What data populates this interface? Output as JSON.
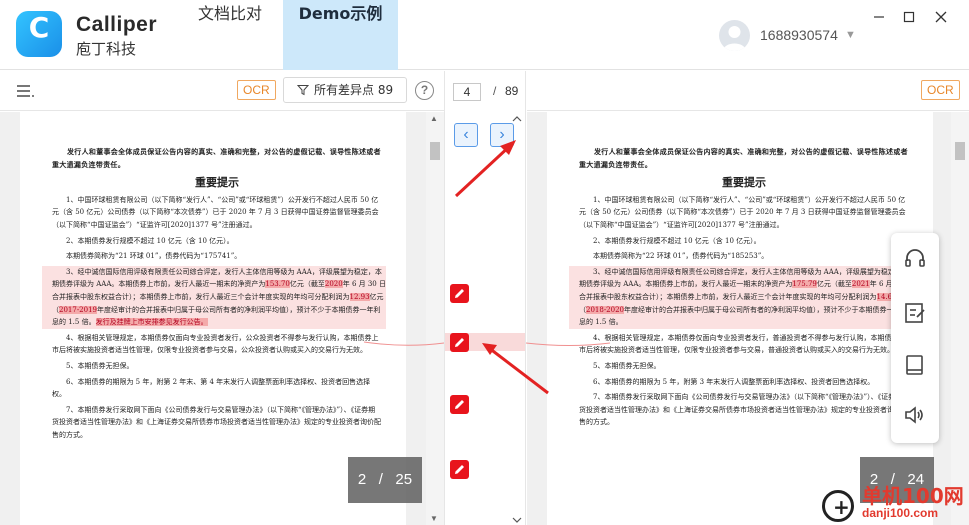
{
  "app": {
    "brand_name": "Calliper",
    "brand_subtitle": "庖丁科技",
    "logo_letter": "C",
    "tabs": [
      {
        "label": "文档比对",
        "active": false
      },
      {
        "label": "Demo示例",
        "active": true
      }
    ],
    "user": {
      "name": "1688930574"
    }
  },
  "colors": {
    "accent": "#1a8fe8",
    "active_tab_bg": "#cde8fa",
    "diff_red": "#e8141c",
    "ocr_orange": "#e8872a"
  },
  "toolbar": {
    "ocr_label": "OCR",
    "diff_filter_label": "所有差异点 89",
    "help_symbol": "?"
  },
  "navigator": {
    "current_diff": "4",
    "separator": "/",
    "total_diffs": "89",
    "prev_symbol": "‹",
    "next_symbol": "›"
  },
  "left_doc": {
    "header": "发行人和董事会全体成员保证公告内容的真实、准确和完整，对公告的虚假记载、误导性陈述或者重大遗漏负连带责任。",
    "heading": "重要提示",
    "p1": "1、中国环球租赁有限公司（以下简称“发行人”、“公司”或“环球租赁”）公开发行不超过人民币 50 亿元（含 50 亿元）公司债券（以下简称“本次债券”）已于 2020 年 7 月 3 日获得中国证券监督管理委员会（以下简称“中国证监会”）“证监许可[2020]1377 号”注册通过。",
    "p2": "2、本期债券发行规模不超过 10 亿元（含 10 亿元）。",
    "p3": "本期债券简称为“21 环球 01”，债券代码为“175741”。",
    "p4_a": "3、经中诚信国际信用评级有限责任公司综合评定，发行人主体信用等级为 AAA，评级展望为稳定，本期债券评级为 AAA。本期债券上市前，发行人最近一期末的净资产为",
    "p4_m1": "153.70",
    "p4_b": "亿元（截至",
    "p4_m2": "2020",
    "p4_c": "年 6 月 30 日合并报表中股东权益合计）；本期债券上市前，发行人最近三个会计年度实现的年均可分配利润为",
    "p4_m3": "12.93",
    "p4_d": "亿元（",
    "p4_m4": "2017-2019",
    "p4_e": "年度经审计的合并报表中归属于母公司所有者的净利润平均值），预计不少于本期债券一年利息的 1.5 倍。",
    "p4_m5": "发行及挂牌上市安排参见发行公告。",
    "p5": "4、根据相关管理规定，本期债券仅面向专业投资者发行，公众投资者不得参与发行认购，本期债券上市后将被实施投资者适当性管理，仅限专业投资者参与交易，公众投资者认购或买入的交易行为无效。",
    "p6": "5、本期债券无担保。",
    "p7": "6、本期债券的期限为 5 年，附第 2 年末、第 4 年末发行人调整票面利率选择权、投资者回售选择权。",
    "p8": "7、本期债券发行采取网下面向《公司债券发行与交易管理办法》（以下简称“《管理办法》”）、《证券期货投资者适当性管理办法》和《上海证券交易所债券市场投资者适当性管理办法》规定的专业投资者询价配售的方式。"
  },
  "right_doc": {
    "header": "发行人和董事会全体成员保证公告内容的真实、准确和完整，对公告的虚假记载、误导性陈述或者重大遗漏负连带责任。",
    "heading": "重要提示",
    "p1": "1、中国环球租赁有限公司（以下简称“发行人”、“公司”或“环球租赁”）公开发行不超过人民币 50 亿元（含 50 亿元）公司债券（以下简称“本次债券”）已于 2020 年 7 月 3 日获得中国证券监督管理委员会（以下简称“中国证监会”）“证监许可[2020]1377 号”注册通过。",
    "p2": "2、本期债券发行规模不超过 10 亿元（含 10 亿元）。",
    "p3": "本期债券简称为“22 环球 01”，债券代码为“185253”。",
    "p4_a": "3、经中诚信国际信用评级有限责任公司综合评定，发行人主体信用等级为 AAA，评级展望为稳定，本期债券评级为 AAA。本期债券上市前，发行人最近一期末的净资产为",
    "p4_m1": "175.79",
    "p4_b": "亿元（截至",
    "p4_m2": "2021",
    "p4_c": "年 6 月 30 日合并报表中股东权益合计）；本期债券上市前，发行人最近三个会计年度实现的年均可分配利润为",
    "p4_m3": "14.67",
    "p4_d": "亿元（",
    "p4_m4": "2018-2020",
    "p4_e": "年度经审计的合并报表中归属于母公司所有者的净利润平均值），预计不少于本期债券一年利息的 1.5 倍。",
    "p5": "4、根据相关管理规定，本期债券仅面向专业投资者发行，普通投资者不得参与发行认购，本期债券上市后将被实施投资者适当性管理，仅限专业投资者参与交易，普通投资者认购或买入的交易行为无效。",
    "p6": "5、本期债券无担保。",
    "p7": "6、本期债券的期限为 5 年，附第 3 年末发行人调整票面利率选择权、投资者回售选择权。",
    "p8": "7、本期债券发行采取网下面向《公司债券发行与交易管理办法》（以下简称“《管理办法》”）、《证券期货投资者适当性管理办法》和《上海证券交易所债券市场投资者适当性管理办法》规定的专业投资者询价配售的方式。"
  },
  "page_indicators": {
    "left": {
      "current": "2",
      "total": "25"
    },
    "right": {
      "current": "2",
      "total": "24"
    }
  },
  "side_panel": {
    "icons": [
      "headset-icon",
      "edit-note-icon",
      "book-icon",
      "speaker-icon"
    ]
  },
  "watermark": {
    "brand": "单机100网",
    "domain": "danji100.com"
  }
}
